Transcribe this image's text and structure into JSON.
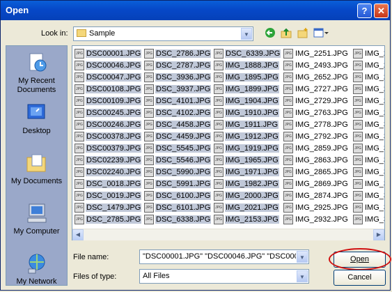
{
  "window": {
    "title": "Open",
    "help_label": "?",
    "close_label": "✕"
  },
  "lookin": {
    "label": "Look in:",
    "value": "Sample"
  },
  "places": [
    {
      "label": "My Recent Documents",
      "icon": "recent-documents-icon"
    },
    {
      "label": "Desktop",
      "icon": "desktop-icon"
    },
    {
      "label": "My Documents",
      "icon": "my-documents-icon"
    },
    {
      "label": "My Computer",
      "icon": "my-computer-icon"
    },
    {
      "label": "My Network",
      "icon": "my-network-icon"
    }
  ],
  "columns": [
    [
      "DSC00001.JPG",
      "DSC00046.JPG",
      "DSC00047.JPG",
      "DSC00108.JPG",
      "DSC00109.JPG",
      "DSC00245.JPG",
      "DSC00246.JPG",
      "DSC00378.JPG",
      "DSC00379.JPG",
      "DSC02239.JPG",
      "DSC02240.JPG",
      "DSC_0018.JPG",
      "DSC_0019.JPG",
      "DSC_1479.JPG",
      "DSC_2785.JPG"
    ],
    [
      "DSC_2786.JPG",
      "DSC_2787.JPG",
      "DSC_3936.JPG",
      "DSC_3937.JPG",
      "DSC_4101.JPG",
      "DSC_4102.JPG",
      "DSC_4458.JPG",
      "DSC_4459.JPG",
      "DSC_5545.JPG",
      "DSC_5546.JPG",
      "DSC_5990.JPG",
      "DSC_5991.JPG",
      "DSC_6100.JPG",
      "DSC_6101.JPG",
      "DSC_6338.JPG"
    ],
    [
      "DSC_6339.JPG",
      "IMG_1888.JPG",
      "IMG_1895.JPG",
      "IMG_1899.JPG",
      "IMG_1904.JPG",
      "IMG_1910.JPG",
      "IMG_1911.JPG",
      "IMG_1912.JPG",
      "IMG_1919.JPG",
      "IMG_1965.JPG",
      "IMG_1971.JPG",
      "IMG_1982.JPG",
      "IMG_2000.JPG",
      "IMG_2021.JPG",
      "IMG_2153.JPG"
    ],
    [
      "IMG_2251.JPG",
      "IMG_2493.JPG",
      "IMG_2652.JPG",
      "IMG_2727.JPG",
      "IMG_2729.JPG",
      "IMG_2763.JPG",
      "IMG_2778.JPG",
      "IMG_2792.JPG",
      "IMG_2859.JPG",
      "IMG_2863.JPG",
      "IMG_2865.JPG",
      "IMG_2869.JPG",
      "IMG_2874.JPG",
      "IMG_2925.JPG",
      "IMG_2932.JPG"
    ],
    [
      "IMG_2",
      "IMG_2",
      "IMG_2",
      "IMG_2",
      "IMG_2",
      "IMG_2",
      "IMG_3",
      "IMG_3",
      "IMG_3",
      "IMG_3",
      "IMG_3",
      "IMG_3",
      "IMG_3",
      "IMG_3",
      "IMG_3"
    ]
  ],
  "selected_columns": 3,
  "file_icon_text": "JPG",
  "filename": {
    "label": "File name:",
    "value": "\"DSC00001.JPG\" \"DSC00046.JPG\" \"DSC000"
  },
  "filetype": {
    "label": "Files of type:",
    "value": "All Files"
  },
  "buttons": {
    "open": "Open",
    "cancel": "Cancel"
  }
}
